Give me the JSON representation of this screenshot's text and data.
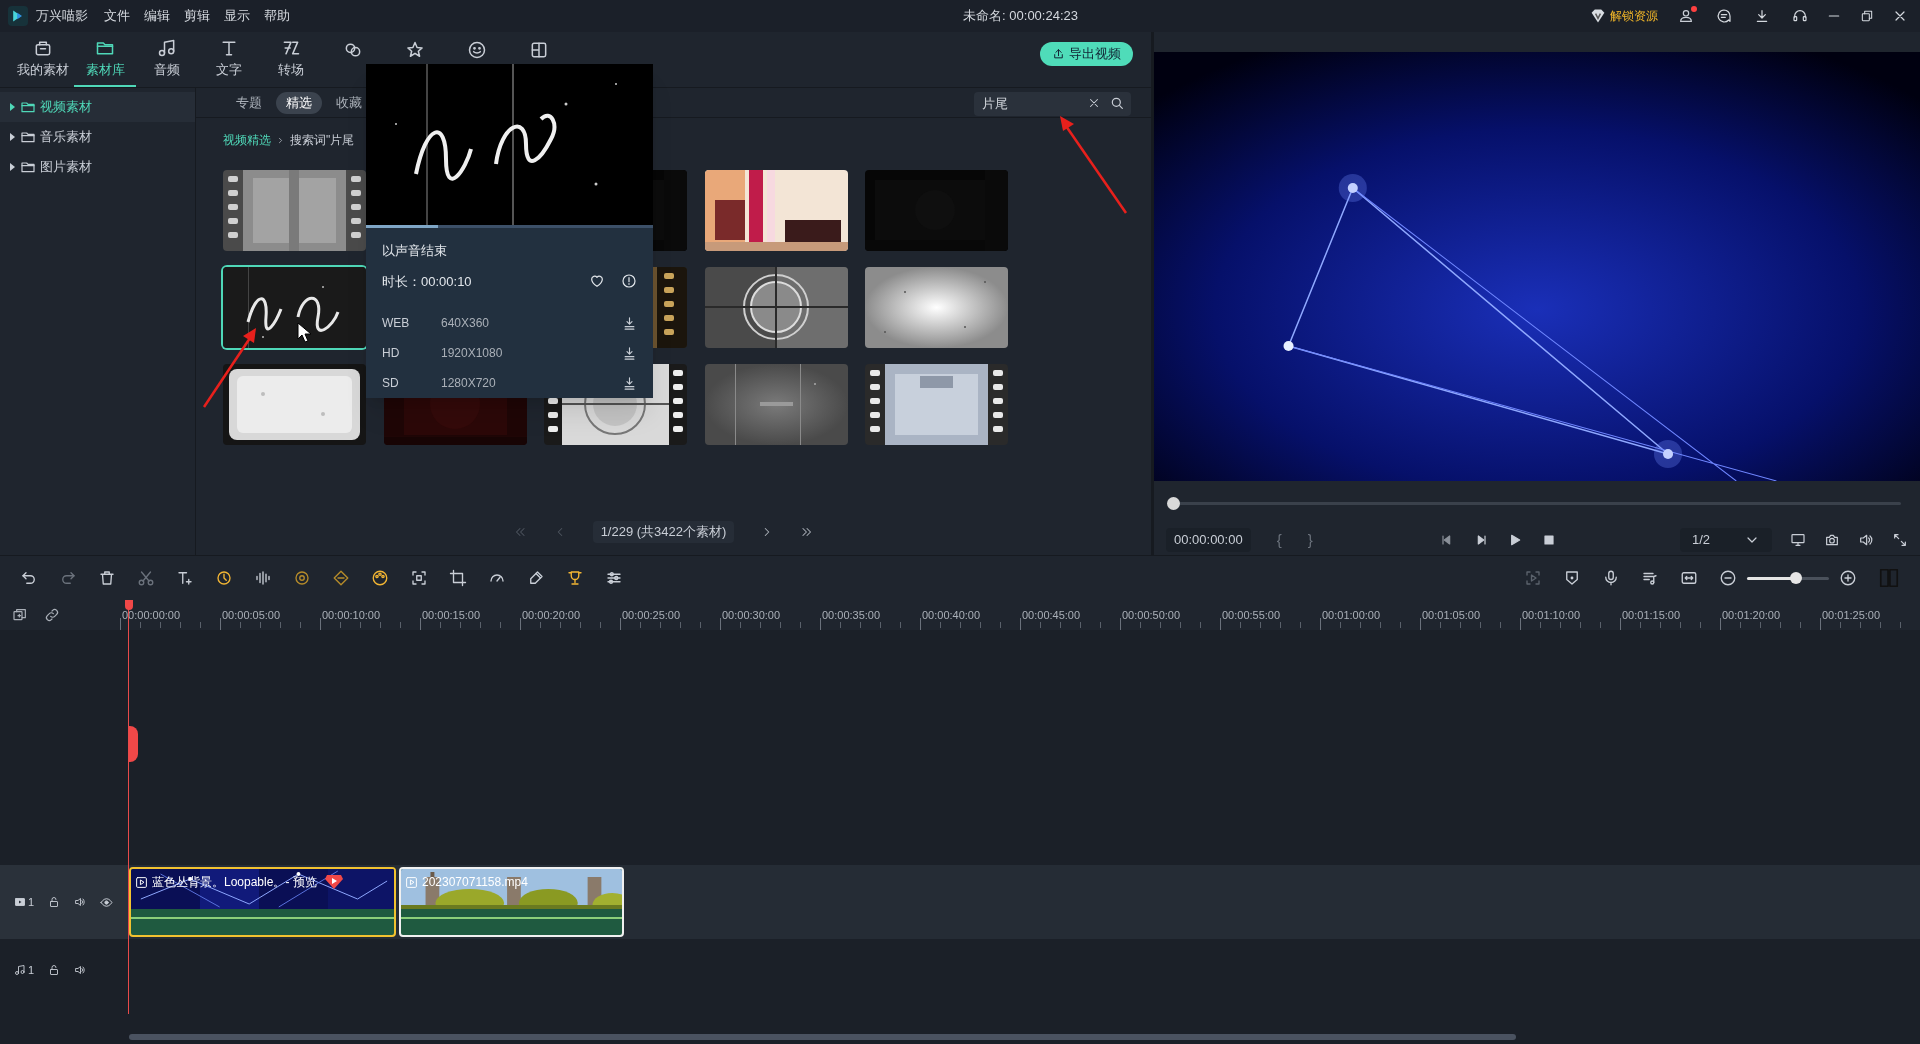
{
  "app": {
    "name": "万兴喵影"
  },
  "menu": [
    "文件",
    "编辑",
    "剪辑",
    "显示",
    "帮助"
  ],
  "title": "未命名: 00:00:24:23",
  "unlock": {
    "label": "解锁资源"
  },
  "account": {
    "has_notification": true
  },
  "media_tabs": [
    {
      "label": "我的素材",
      "selected": false
    },
    {
      "label": "素材库",
      "selected": true
    },
    {
      "label": "音频",
      "selected": false
    },
    {
      "label": "文字",
      "selected": false
    },
    {
      "label": "转场",
      "selected": false
    },
    {
      "selected": false
    },
    {
      "selected": false
    },
    {
      "selected": false
    },
    {
      "selected": false
    }
  ],
  "export_button": "导出视频",
  "library_tree": [
    {
      "label": "视频素材",
      "selected": true,
      "expanded": false
    },
    {
      "label": "音乐素材",
      "selected": false,
      "expanded": false
    },
    {
      "label": "图片素材",
      "selected": false,
      "expanded": false
    }
  ],
  "sub_tabs": [
    {
      "label": "专题",
      "selected": false
    },
    {
      "label": "精选",
      "selected": true
    },
    {
      "label": "收藏",
      "selected": false
    }
  ],
  "search": {
    "value": "片尾"
  },
  "breadcrumb": [
    "视频精选",
    "搜索词\"片尾"
  ],
  "thumbnails": [
    {
      "kind": "picture",
      "selected": false
    },
    {
      "kind": "covered"
    },
    {
      "kind": "picture",
      "selected": false
    },
    {
      "kind": "picture",
      "selected": false
    },
    {
      "kind": "picture",
      "selected": false
    },
    {
      "kind": "picture",
      "selected": true
    },
    {
      "kind": "covered"
    },
    {
      "kind": "picture",
      "selected": false
    },
    {
      "kind": "picture",
      "selected": false
    },
    {
      "kind": "picture",
      "selected": false
    },
    {
      "kind": "picture",
      "selected": false
    },
    {
      "kind": "picture",
      "selected": false
    },
    {
      "kind": "picture",
      "selected": false
    },
    {
      "kind": "picture",
      "selected": false
    },
    {
      "kind": "picture",
      "selected": false
    }
  ],
  "popup": {
    "title": "以声音结束",
    "duration": "时长：00:00:10",
    "level": 0.25,
    "formats": [
      {
        "name": "WEB",
        "resolution": "640X360"
      },
      {
        "name": "HD",
        "resolution": "1920X1080"
      },
      {
        "name": "SD",
        "resolution": "1280X720"
      }
    ]
  },
  "pagination": {
    "page": "1/229 (共3422个素材)",
    "buttons": [
      {
        "disabled": true
      },
      {
        "disabled": true
      },
      {
        "disabled": false
      },
      {
        "disabled": false
      }
    ]
  },
  "preview": {
    "level": 0,
    "timecode": "00:00:00:00",
    "marks": [
      "{",
      "}"
    ],
    "quality": "1/2"
  },
  "timeline": {
    "zoom": {
      "level": 0.6
    },
    "ruler": [
      "00:00:00:00",
      "00:00:05:00",
      "00:00:10:00",
      "00:00:15:00",
      "00:00:20:00",
      "00:00:25:00",
      "00:00:30:00",
      "00:00:35:00",
      "00:00:40:00",
      "00:00:45:00",
      "00:00:50:00",
      "00:00:55:00",
      "00:01:00:00",
      "00:01:05:00",
      "00:01:10:00",
      "00:01:15:00",
      "00:01:20:00",
      "00:01:25:00"
    ],
    "tracks": [
      {
        "kind": "video",
        "number": "1",
        "clips": [
          {
            "title": "蓝色丛背景。Loopable。- 预览",
            "selected": true,
            "preview_badge": true
          },
          {
            "title": "202307071158.mp4",
            "selected": false,
            "preview_badge": false
          }
        ]
      },
      {
        "kind": "audio",
        "number": "1"
      }
    ]
  }
}
